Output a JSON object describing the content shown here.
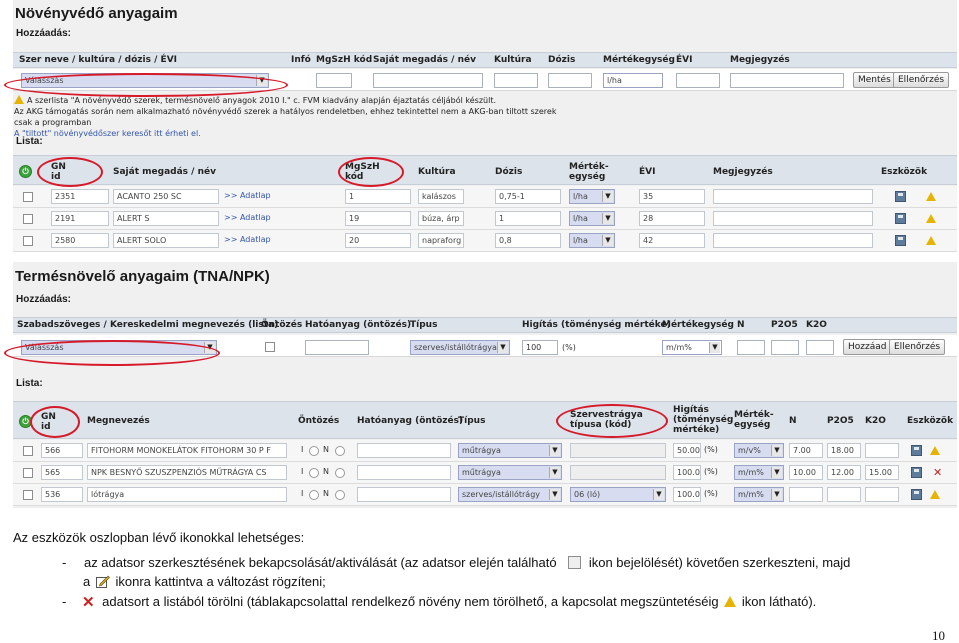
{
  "panel1": {
    "title": "Növényvédő anyagaim",
    "add_label": "Hozzáadás:",
    "headers": [
      "Szer neve / kultúra / dózis / ÉVI",
      "Infó",
      "MgSzH kód",
      "Saját megadás / név",
      "Kultúra",
      "Dózis",
      "Mértékegység",
      "ÉVI",
      "Megjegyzés"
    ],
    "add_row": {
      "select_value": "Válasszás",
      "unit_value": "l/ha",
      "save_button": "Mentés",
      "check_button": "Ellenőrzés"
    },
    "notice": {
      "line1": "A szerlista \"A növényvédő szerek, termésnövelő anyagok 2010 I.\" c. FVM kiadvány alapján éjaztatás céljából készült.",
      "line2": "Az AKG támogatás során nem alkalmazható növényvédő szerek a hatályos rendeletben, ehhez tekintettel nem a AKG-ban tiltott szerek csak a programban",
      "line3": "A \"tiltott\" növényvédőszer keresőt itt érheti el."
    },
    "list_label": "Lista:",
    "list_headers": {
      "gn_id": "GN\nid",
      "own_name": "Saját megadás / név",
      "mgszh": "MgSzH\nkód",
      "culture": "Kultúra",
      "dose": "Dózis",
      "unit": "Mérték-\negység",
      "evi": "ÉVI",
      "note": "Megjegyzés",
      "tools": "Eszközök"
    },
    "rows": [
      {
        "id": "2351",
        "name": "ACANTO 250 SC",
        "link": ">> Adatlap",
        "mgszh": "1",
        "culture": "kalászos",
        "dose": "0,75-1",
        "unit": "l/ha",
        "evi": "35"
      },
      {
        "id": "2191",
        "name": "ALERT S",
        "link": ">> Adatlap",
        "mgszh": "19",
        "culture": "búza, árp",
        "dose": "1",
        "unit": "l/ha",
        "evi": "28"
      },
      {
        "id": "2580",
        "name": "ALERT SOLO",
        "link": ">> Adatlap",
        "mgszh": "20",
        "culture": "napraforg",
        "dose": "0,8",
        "unit": "l/ha",
        "evi": "42"
      }
    ]
  },
  "panel2": {
    "title": "Termésnövelő anyagaim (TNA/NPK)",
    "add_label": "Hozzáadás:",
    "headers": [
      "Szabadszöveges / Kereskedelmi megnevezés (lista)",
      "Öntözés",
      "Hatóanyag (öntözés)",
      "Típus",
      "Higítás (töménység mértéke)",
      "Mértékegység",
      "N",
      "P2O5",
      "K2O"
    ],
    "add_row": {
      "select_value": "Válasszás",
      "type_value": "szerves/istállótrágya",
      "dilution_value": "100",
      "pct": "(%)",
      "unit_value": "m/m%",
      "add_button": "Hozzáad",
      "check_button": "Ellenőrzés"
    },
    "list_label": "Lista:",
    "list_headers": {
      "gn_id": "GN\nid",
      "name": "Megnevezés",
      "irrigation": "Öntözés",
      "active": "Hatóanyag (öntözés)",
      "type": "Típus",
      "fert_type": "Szervestrágya\ntípusa (kód)",
      "dilution": "Higítás\n(töménység\nmértéke)",
      "unit": "Mérték-\negység",
      "n": "N",
      "p2o5": "P2O5",
      "k2o": "K2O",
      "tools": "Eszközök"
    },
    "radio_i": "I",
    "radio_n": "N",
    "rows": [
      {
        "id": "566",
        "name": "FITOHORM MONOKELÁTOK FITOHORM 30 P F",
        "type": "műtrágya",
        "fert_type": "",
        "dilution": "50.00",
        "pct": "(%)",
        "unit": "m/v%",
        "n": "7.00",
        "p2o5": "18.00",
        "k2o": ""
      },
      {
        "id": "565",
        "name": "NPK BESNYŐ SZUSZPENZIÓS MŰTRÁGYA CS",
        "type": "műtrágya",
        "fert_type": "",
        "dilution": "100.0",
        "pct": "(%)",
        "unit": "m/m%",
        "n": "10.00",
        "p2o5": "12.00",
        "k2o": "15.00"
      },
      {
        "id": "536",
        "name": "lótrágya",
        "type": "szerves/istállótrágy",
        "fert_type": "06 (ló)",
        "dilution": "100.0",
        "pct": "(%)",
        "unit": "m/m%",
        "n": "",
        "p2o5": "",
        "k2o": ""
      }
    ]
  },
  "caption": {
    "intro": "Az eszközök oszlopban lévő ikonokkal lehetséges:",
    "bullet1_a": "-",
    "bullet1_b": "az adatsor szerkesztésének bekapcsolását/aktiválását (az adatsor elején található",
    "bullet1_c": "ikon bejelölését) követően szerkeszteni, majd",
    "bullet1_d": "a",
    "bullet1_e": "ikonra kattintva a változást rögzíteni;",
    "bullet2_a": "-",
    "bullet2_b": "adatsort a listából törölni (táblakapcsolattal rendelkező növény nem törölhető, a kapcsolat megszüntetéséig",
    "bullet2_c": "ikon látható)."
  },
  "page_number": "10",
  "colors": {
    "accent_red": "#d61a2a",
    "link_blue": "#3355aa",
    "header_bg": "#dde3ea",
    "panel_bg": "#f0f0f0"
  }
}
